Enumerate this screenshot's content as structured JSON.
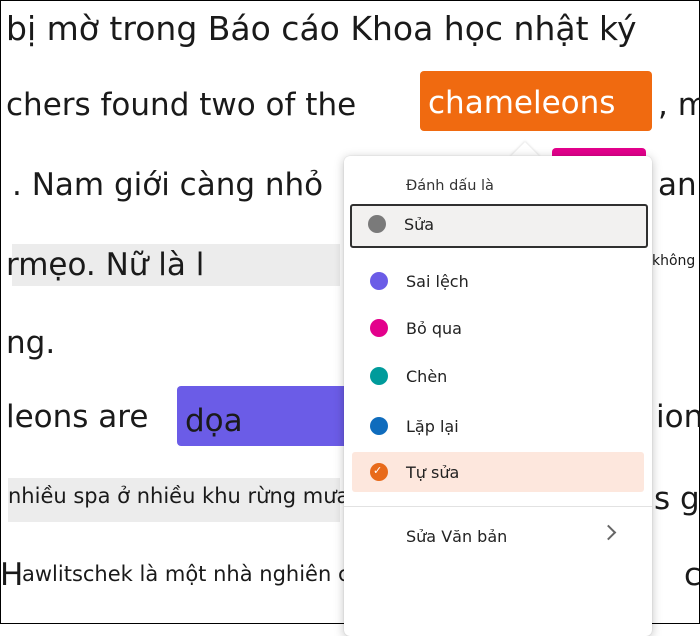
{
  "document": {
    "line1": "bị mờ trong Báo cáo Khoa học nhật ký",
    "line2": "chers found two of the",
    "line2_highlight": "chameleons",
    "line2_right": ", m",
    "line3": ". Nam giới càng nhỏ",
    "line3_right": "an",
    "line4": "rmẹo. Nữ là l",
    "line4_right": "không",
    "line5": "ng.",
    "line6_left": "leons are",
    "line6_highlight": "dọa",
    "line6_right": "ion",
    "line7": "nhiều spa ở nhiều khu rừng mưa",
    "line7_right": "s g",
    "line8_lead": "H",
    "line8": "awlitschek là một nhà nghiên cứu sinh tại mười trung tâm",
    "line8_right": "c"
  },
  "menu": {
    "header": "Đánh dấu là",
    "items": [
      {
        "label": "Sửa",
        "color": "#7a7a7a"
      },
      {
        "label": "Sai lệch",
        "color": "#6b5ce7"
      },
      {
        "label": "Bỏ qua",
        "color": "#e3008c"
      },
      {
        "label": "Chèn",
        "color": "#009b9b"
      },
      {
        "label": "Lặp lại",
        "color": "#0f6cbd"
      },
      {
        "label": "Tự sửa",
        "color": "#e86a1a"
      }
    ],
    "edit_text": "Sửa Văn bản"
  },
  "colors": {
    "orange": "#f06a10",
    "purple": "#6b5ce7",
    "magenta": "#e3008c"
  }
}
